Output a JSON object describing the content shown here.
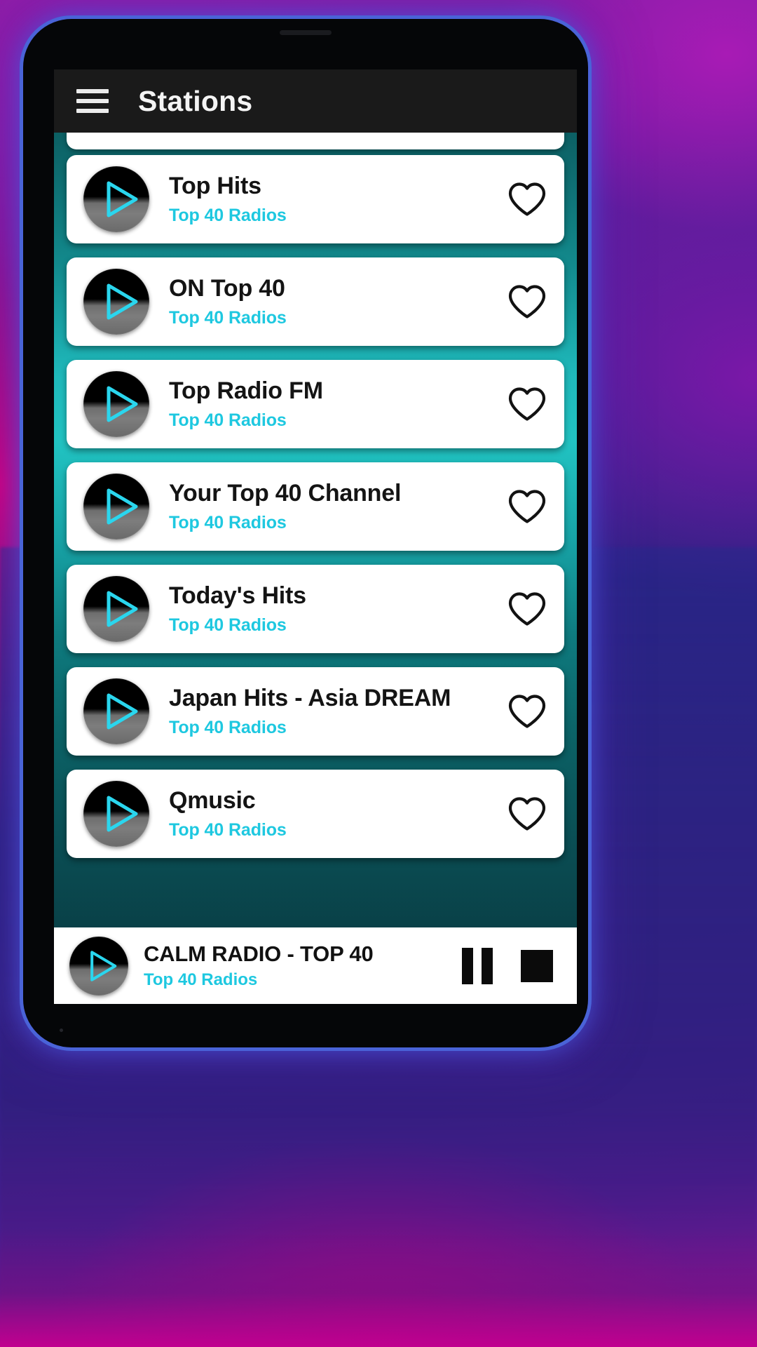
{
  "app": {
    "title": "Stations",
    "menu_icon": "hamburger-menu-icon"
  },
  "theme": {
    "accent_cyan": "#1ec8e0",
    "app_background_teal": "#14a2a5",
    "appbar_background": "#1a1a1a",
    "card_background": "#ffffff",
    "title_text": "#141414",
    "device_bezel": "#4a63d8"
  },
  "stations": [
    {
      "name": "Top Hits",
      "category": "Top 40 Radios",
      "favorite": false
    },
    {
      "name": "ON Top 40",
      "category": "Top 40 Radios",
      "favorite": false
    },
    {
      "name": "Top Radio FM",
      "category": "Top 40 Radios",
      "favorite": false
    },
    {
      "name": "Your Top 40 Channel",
      "category": "Top 40 Radios",
      "favorite": false
    },
    {
      "name": "Today's Hits",
      "category": "Top 40 Radios",
      "favorite": false
    },
    {
      "name": "Japan Hits - Asia DREAM",
      "category": "Top 40 Radios",
      "favorite": false
    },
    {
      "name": "Qmusic",
      "category": "Top 40 Radios",
      "favorite": false
    }
  ],
  "player": {
    "now_playing_title": "CALM RADIO - TOP 40",
    "now_playing_category": "Top 40 Radios",
    "pause_label": "pause-button",
    "stop_label": "stop-button"
  }
}
